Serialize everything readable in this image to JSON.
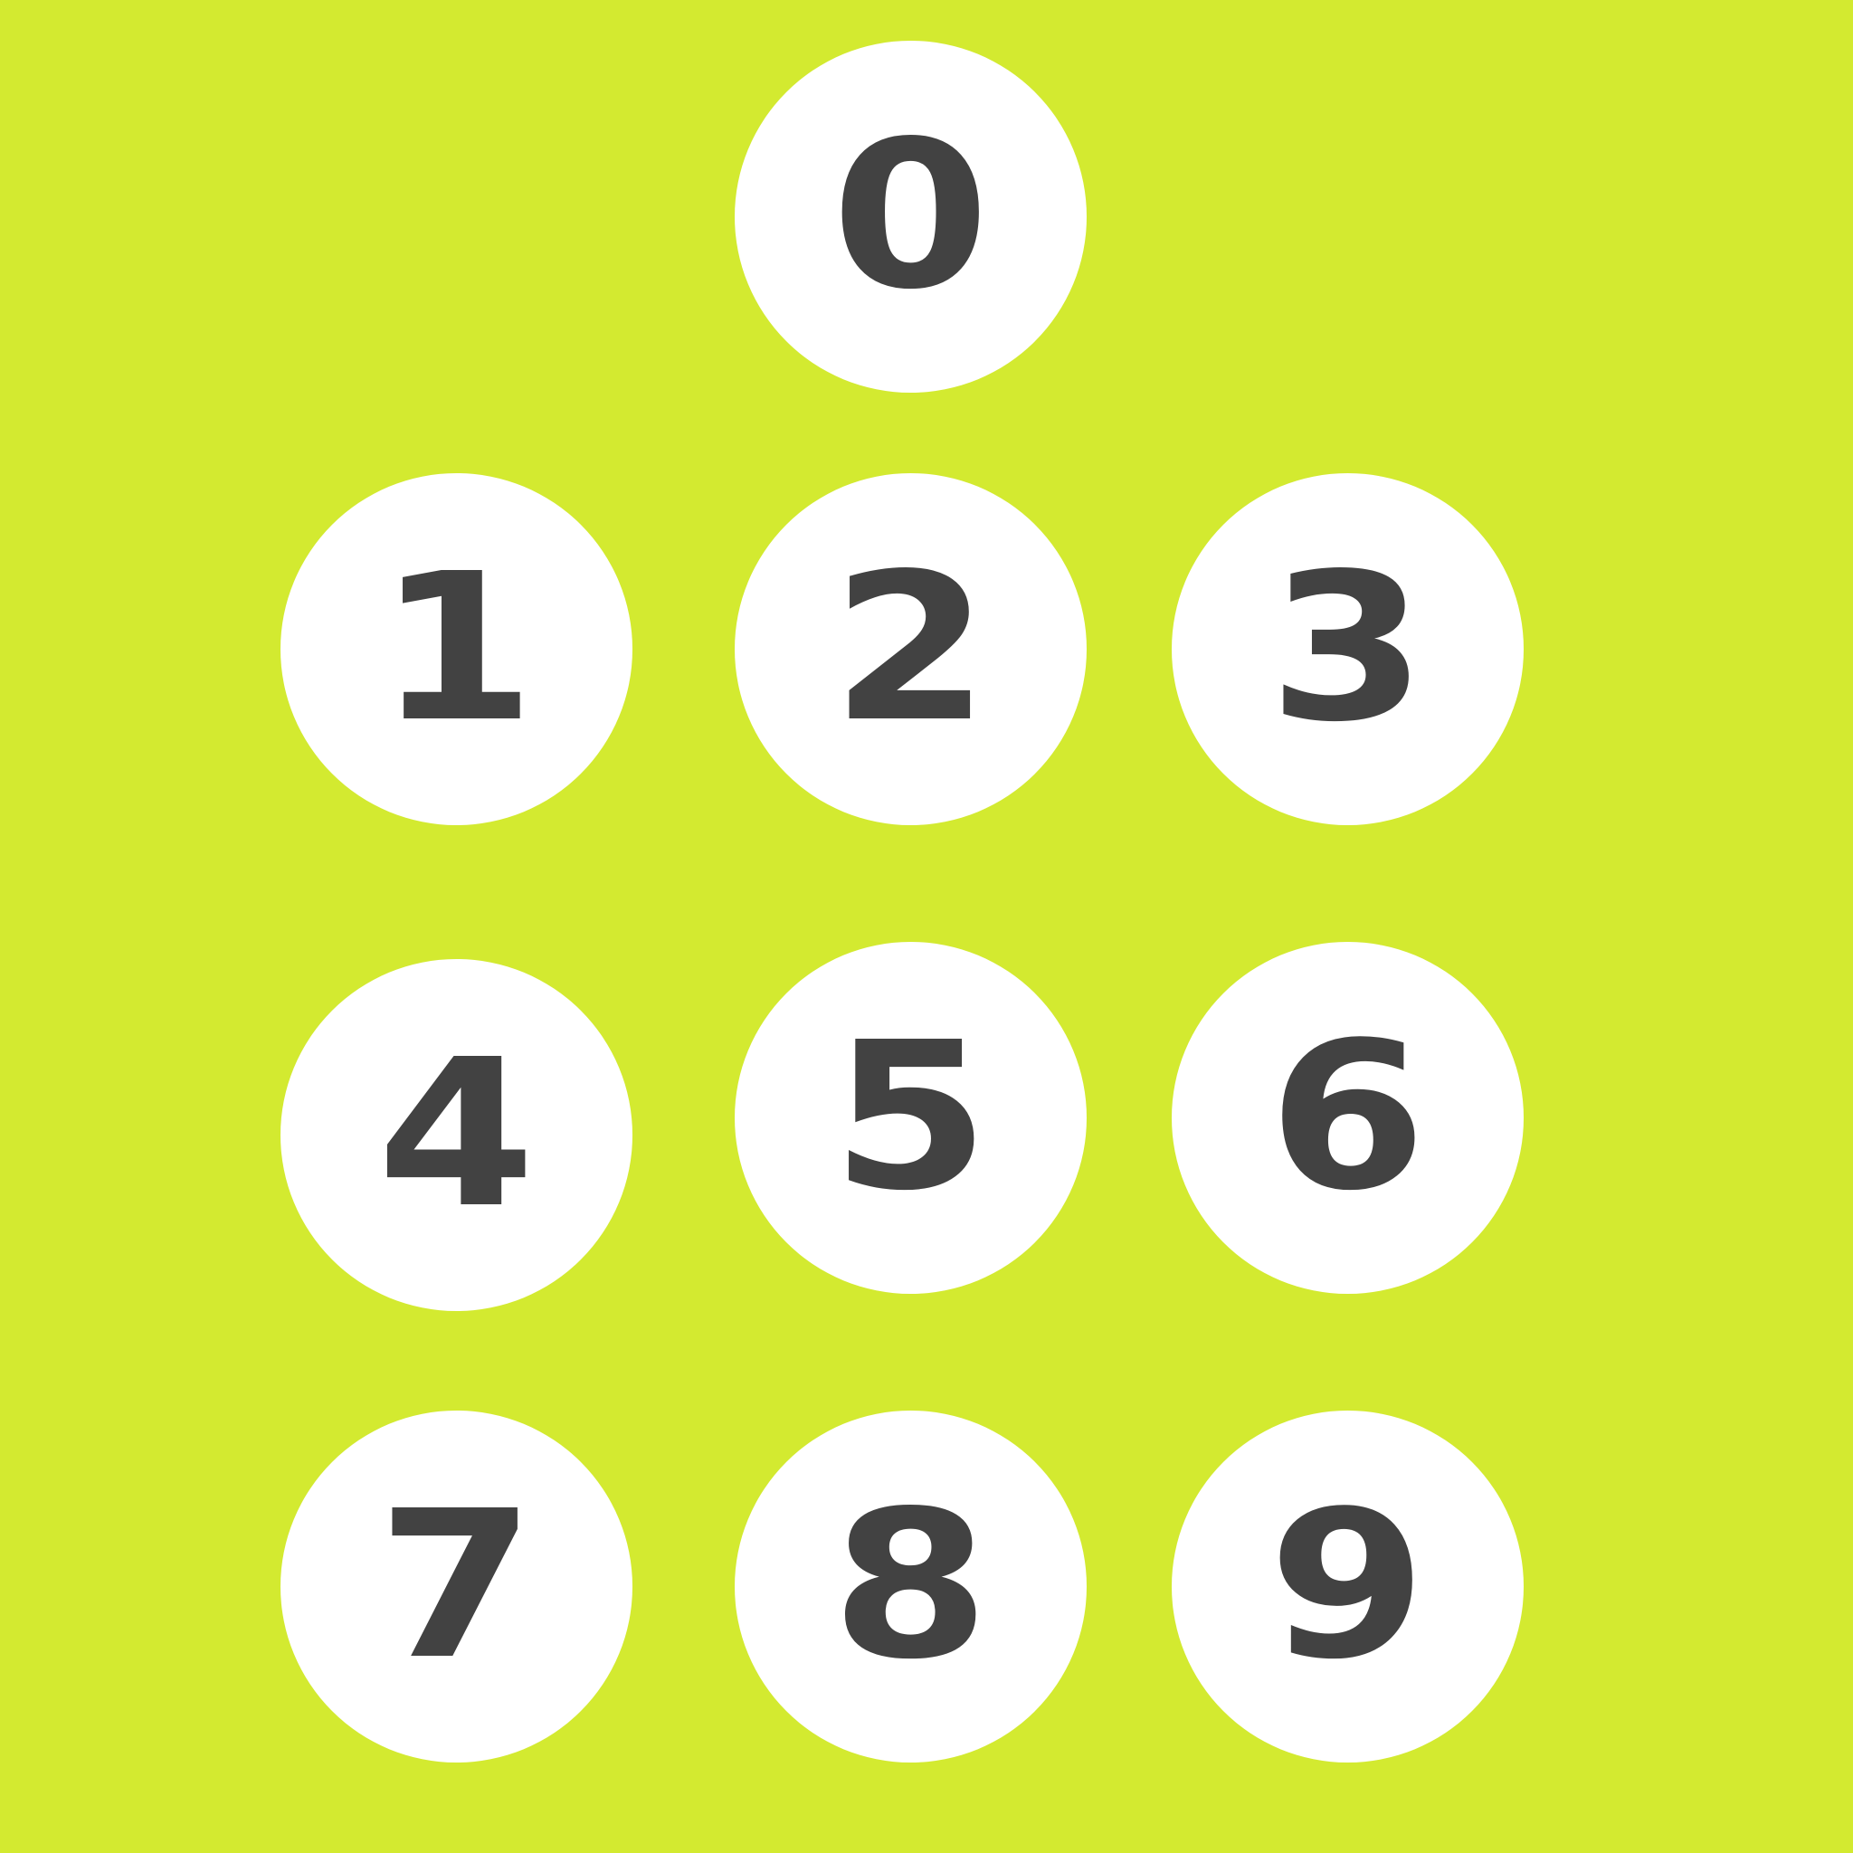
{
  "colors": {
    "background": "#d3ea30",
    "key_fill": "#ffffff",
    "digit": "#424242"
  },
  "keys": [
    {
      "label": "0"
    },
    {
      "label": "1"
    },
    {
      "label": "2"
    },
    {
      "label": "3"
    },
    {
      "label": "4"
    },
    {
      "label": "5"
    },
    {
      "label": "6"
    },
    {
      "label": "7"
    },
    {
      "label": "8"
    },
    {
      "label": "9"
    }
  ]
}
